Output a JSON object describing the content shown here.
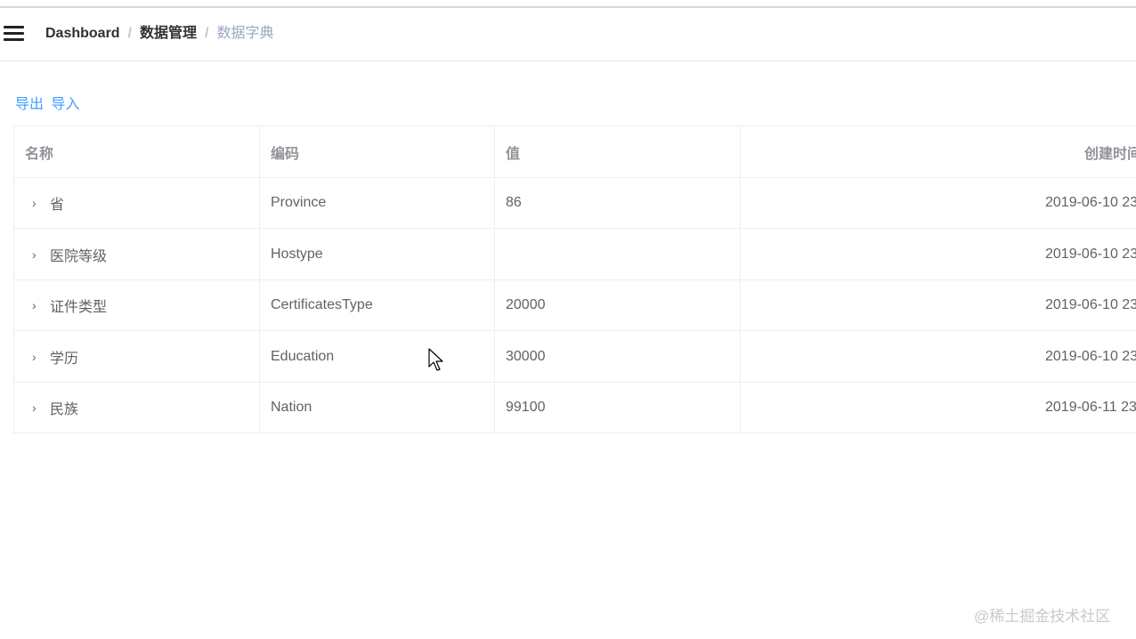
{
  "breadcrumb": {
    "items": [
      "Dashboard",
      "数据管理",
      "数据字典"
    ],
    "separator": "/"
  },
  "actions": {
    "export_label": "导出",
    "import_label": "导入"
  },
  "table": {
    "columns": [
      "名称",
      "编码",
      "值",
      "创建时间"
    ],
    "rows": [
      {
        "name": "省",
        "code": "Province",
        "value": "86",
        "created": "2019-06-10 23"
      },
      {
        "name": "医院等级",
        "code": "Hostype",
        "value": "",
        "created": "2019-06-10 23"
      },
      {
        "name": "证件类型",
        "code": "CertificatesType",
        "value": "20000",
        "created": "2019-06-10 23"
      },
      {
        "name": "学历",
        "code": "Education",
        "value": "30000",
        "created": "2019-06-10 23"
      },
      {
        "name": "民族",
        "code": "Nation",
        "value": "99100",
        "created": "2019-06-11 23"
      }
    ],
    "expand_icon": "chevron-right-icon"
  },
  "watermark": "@稀土掘金技术社区",
  "colors": {
    "link": "#409eff",
    "border": "#ebeef5",
    "header_text": "#909399",
    "body_text": "#606266"
  }
}
